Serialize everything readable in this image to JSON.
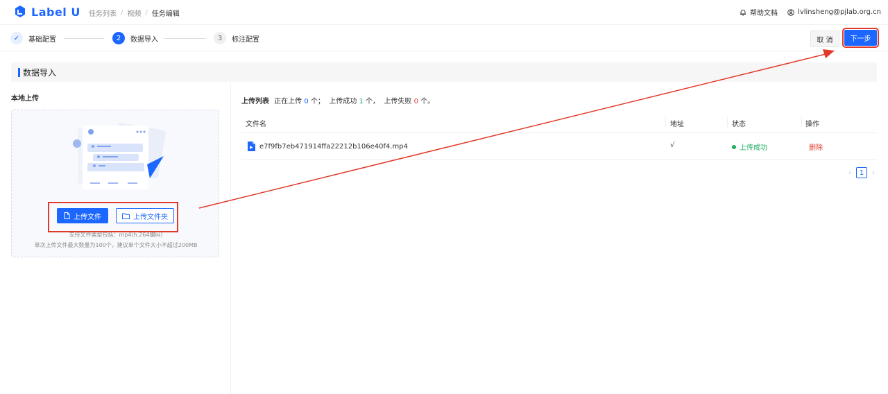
{
  "app": {
    "logo_text": "Label U"
  },
  "breadcrumb": {
    "items": [
      "任务列表",
      "视频",
      "任务编辑"
    ]
  },
  "header_right": {
    "help_label": "帮助文档",
    "user_email": "lvlinsheng@pjlab.org.cn"
  },
  "steps": [
    {
      "number": "✓",
      "label": "基础配置"
    },
    {
      "number": "2",
      "label": "数据导入"
    },
    {
      "number": "3",
      "label": "标注配置"
    }
  ],
  "actions": {
    "cancel_label": "取 消",
    "next_label": "下一步"
  },
  "section": {
    "title": "数据导入"
  },
  "local_upload": {
    "title": "本地上传",
    "upload_file_label": "上传文件",
    "upload_folder_label": "上传文件夹",
    "hint_types": "支持文件类型包括：mp4(h.264编码)",
    "hint_limit": "单次上传文件最大数量为100个，建议单个文件大小不超过200MB"
  },
  "upload_list": {
    "label": "上传列表",
    "uploading_text": "正在上传",
    "uploading_count": "0",
    "unit1": "个；",
    "success_text": "上传成功",
    "success_count": "1",
    "unit2": "个，",
    "failed_text": "上传失败",
    "failed_count": "0",
    "unit3": "个。"
  },
  "table": {
    "columns": [
      "文件名",
      "地址",
      "状态",
      "操作"
    ],
    "rows": [
      {
        "filename": "e7f9fb7eb471914ffa22212b106e40f4.mp4",
        "address": "√",
        "status": "上传成功",
        "action": "删除"
      }
    ]
  },
  "pagination": {
    "current_page": "1",
    "prev": "‹",
    "next": "›"
  },
  "colors": {
    "primary": "#1b67ff",
    "success": "#1fae62",
    "danger": "#e23a2a",
    "annotation": "#e23a2a"
  }
}
